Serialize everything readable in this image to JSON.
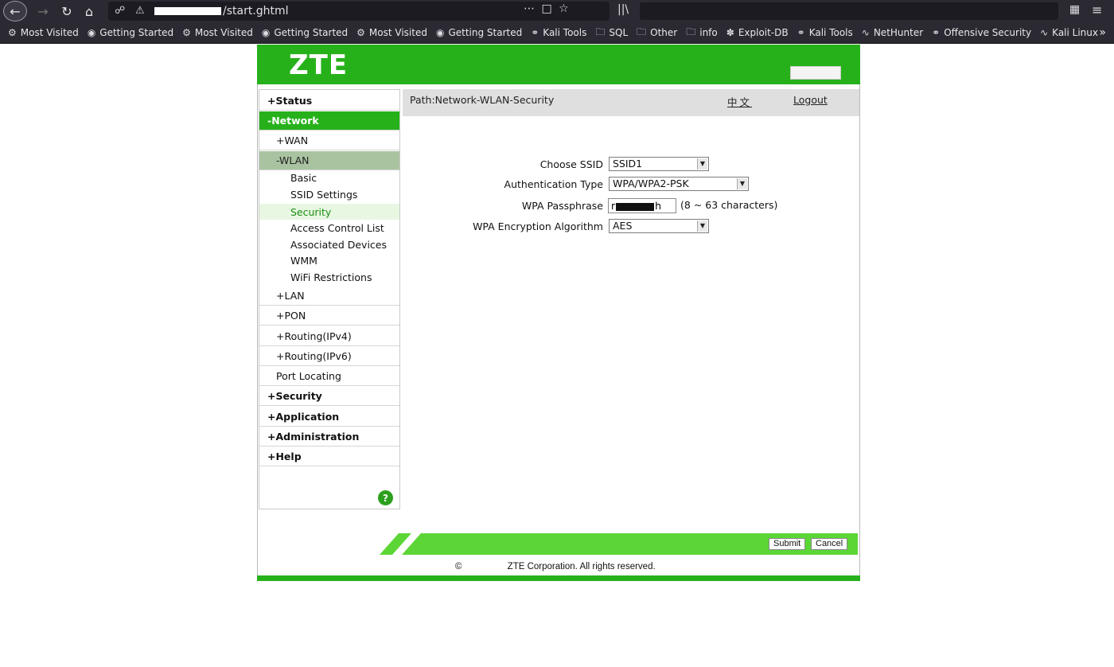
{
  "browser": {
    "url_text": "/start.ghtml",
    "bookmarks": [
      {
        "label": "Most Visited",
        "icon": "gear-icon"
      },
      {
        "label": "Getting Started",
        "icon": "firefox-icon"
      },
      {
        "label": "Most Visited",
        "icon": "gear-icon"
      },
      {
        "label": "Getting Started",
        "icon": "firefox-icon"
      },
      {
        "label": "Most Visited",
        "icon": "gear-icon"
      },
      {
        "label": "Getting Started",
        "icon": "firefox-icon"
      },
      {
        "label": "Kali Tools",
        "icon": "globe-icon"
      },
      {
        "label": "SQL",
        "icon": "folder-icon"
      },
      {
        "label": "Other",
        "icon": "folder-icon"
      },
      {
        "label": "info",
        "icon": "folder-icon"
      },
      {
        "label": "Exploit-DB",
        "icon": "bug-icon"
      },
      {
        "label": "Kali Tools",
        "icon": "globe-icon"
      },
      {
        "label": "NetHunter",
        "icon": "dragon-icon"
      },
      {
        "label": "Offensive Security",
        "icon": "globe-icon"
      },
      {
        "label": "Kali Linux",
        "icon": "dragon-icon"
      }
    ]
  },
  "header": {
    "logo": "ZTE"
  },
  "sidebar": {
    "status": "+Status",
    "network": "-Network",
    "wan": "+WAN",
    "wlan": "-WLAN",
    "basic": "Basic",
    "ssid_settings": "SSID Settings",
    "security_leaf": "Security",
    "acl": "Access Control List",
    "associated": "Associated Devices",
    "wmm": "WMM",
    "wifi_restrictions": "WiFi Restrictions",
    "lan": "+LAN",
    "pon": "+PON",
    "routing4": "+Routing(IPv4)",
    "routing6": "+Routing(IPv6)",
    "port_locating": "Port Locating",
    "security": "+Security",
    "application": "+Application",
    "administration": "+Administration",
    "help": "+Help",
    "help_icon": "?"
  },
  "path": {
    "text": "Path:Network-WLAN-Security",
    "lang": "中文",
    "logout": "Logout"
  },
  "form": {
    "ssid_label": "Choose SSID",
    "ssid_value": "SSID1",
    "auth_label": "Authentication Type",
    "auth_value": "WPA/WPA2-PSK",
    "pass_label": "WPA Passphrase",
    "pass_value": "r",
    "pass_value_end": "h",
    "pass_hint": "(8 ~ 63 characters)",
    "enc_label": "WPA Encryption Algorithm",
    "enc_value": "AES"
  },
  "footer": {
    "submit": "Submit",
    "cancel": "Cancel",
    "copyright_prefix": "©",
    "copyright_suffix": " ZTE Corporation. All rights reserved."
  },
  "colors": {
    "brand_green": "#26b11b",
    "wlan_selected": "#a9c3a1"
  }
}
